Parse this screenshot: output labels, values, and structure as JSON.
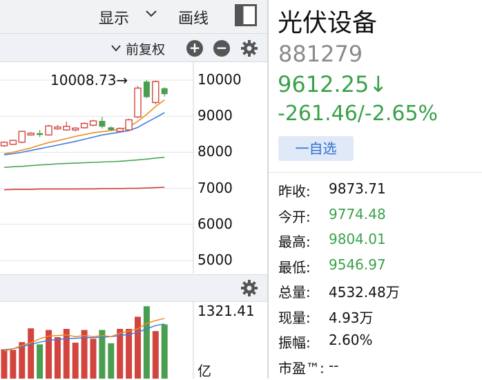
{
  "toolbar": {
    "display_label": "显示",
    "draw_label": "画线",
    "adjust_label": "前复权"
  },
  "price_axis": {
    "ticks": [
      "10000",
      "9000",
      "8000",
      "7000",
      "6000",
      "5000"
    ]
  },
  "high_annotation": "10008.73→",
  "volume_axis": {
    "top_value": "1321.41",
    "unit": "亿"
  },
  "stock": {
    "name": "光伏设备",
    "code": "881279",
    "price": "9612.25↓",
    "change": "-261.46/-2.65%",
    "watchlist_label": "一自选"
  },
  "quote": [
    {
      "label": "昨收:",
      "value": "9873.71",
      "color": "#111111"
    },
    {
      "label": "今开:",
      "value": "9774.48",
      "color": "#3aa14a"
    },
    {
      "label": "最高:",
      "value": "9804.01",
      "color": "#3aa14a"
    },
    {
      "label": "最低:",
      "value": "9546.97",
      "color": "#3aa14a"
    },
    {
      "label": "总量:",
      "value": "4532.48万",
      "color": "#111111"
    },
    {
      "label": "现量:",
      "value": "4.93万",
      "color": "#111111"
    },
    {
      "label": "振幅:",
      "value": "2.60%",
      "color": "#111111"
    },
    {
      "label": "市盈™:",
      "value": "--",
      "color": "#111111"
    }
  ],
  "colors": {
    "up": "#d2453e",
    "down": "#4a9e4f",
    "ma5": "#f08a22",
    "ma10": "#3d7de0",
    "ma30": "#4aa653",
    "ma60": "#d23f38"
  },
  "chart_data": {
    "type": "candlestick",
    "price_ylim": [
      5000,
      10200
    ],
    "candles": [
      {
        "o": 8180,
        "c": 8280,
        "h": 8300,
        "l": 8150,
        "dir": "up"
      },
      {
        "o": 8220,
        "c": 8330,
        "h": 8350,
        "l": 8200,
        "dir": "up"
      },
      {
        "o": 8280,
        "c": 8580,
        "h": 8600,
        "l": 8250,
        "dir": "up"
      },
      {
        "o": 8480,
        "c": 8530,
        "h": 8560,
        "l": 8460,
        "dir": "up"
      },
      {
        "o": 8530,
        "c": 8480,
        "h": 8620,
        "l": 8420,
        "dir": "down"
      },
      {
        "o": 8480,
        "c": 8730,
        "h": 8760,
        "l": 8460,
        "dir": "up"
      },
      {
        "o": 8650,
        "c": 8700,
        "h": 8760,
        "l": 8620,
        "dir": "up"
      },
      {
        "o": 8620,
        "c": 8720,
        "h": 8850,
        "l": 8600,
        "dir": "up"
      },
      {
        "o": 8620,
        "c": 8670,
        "h": 8700,
        "l": 8580,
        "dir": "up"
      },
      {
        "o": 8680,
        "c": 8800,
        "h": 8830,
        "l": 8660,
        "dir": "up"
      },
      {
        "o": 8750,
        "c": 8870,
        "h": 8900,
        "l": 8720,
        "dir": "up"
      },
      {
        "o": 8870,
        "c": 8710,
        "h": 8980,
        "l": 8660,
        "dir": "down"
      },
      {
        "o": 8690,
        "c": 8620,
        "h": 8720,
        "l": 8600,
        "dir": "down"
      },
      {
        "o": 8580,
        "c": 8660,
        "h": 8690,
        "l": 8560,
        "dir": "up"
      },
      {
        "o": 8620,
        "c": 8900,
        "h": 8930,
        "l": 8600,
        "dir": "up"
      },
      {
        "o": 8980,
        "c": 9780,
        "h": 9840,
        "l": 8950,
        "dir": "up"
      },
      {
        "o": 9960,
        "c": 9530,
        "h": 10008.73,
        "l": 9500,
        "dir": "down"
      },
      {
        "o": 9380,
        "c": 9960,
        "h": 9990,
        "l": 9330,
        "dir": "up"
      },
      {
        "o": 9774.48,
        "c": 9612.25,
        "h": 9804.01,
        "l": 9546.97,
        "dir": "down"
      }
    ],
    "ma5": [
      7960,
      8000,
      8060,
      8120,
      8200,
      8270,
      8320,
      8380,
      8440,
      8490,
      8540,
      8570,
      8600,
      8640,
      8700,
      8860,
      9050,
      9270,
      9450
    ],
    "ma10": [
      7930,
      7960,
      8000,
      8050,
      8100,
      8150,
      8200,
      8250,
      8300,
      8360,
      8420,
      8480,
      8520,
      8560,
      8600,
      8690,
      8830,
      8960,
      9100
    ],
    "ma30": [
      7580,
      7600,
      7610,
      7630,
      7650,
      7660,
      7680,
      7690,
      7700,
      7710,
      7720,
      7730,
      7740,
      7750,
      7770,
      7790,
      7810,
      7840,
      7860
    ],
    "ma60": [
      6960,
      6970,
      6970,
      6970,
      6980,
      6980,
      6980,
      6980,
      6980,
      6985,
      6985,
      6990,
      6990,
      6995,
      7000,
      7000,
      7010,
      7020,
      7030
    ],
    "volume_ylim": [
      0,
      1400
    ],
    "volume": [
      530,
      520,
      660,
      910,
      620,
      880,
      750,
      900,
      650,
      880,
      720,
      880,
      640,
      900,
      900,
      1120,
      1310,
      860,
      980
    ],
    "vol_ma5": [
      500,
      540,
      600,
      650,
      720,
      770,
      780,
      790,
      760,
      780,
      760,
      780,
      760,
      820,
      860,
      900,
      1000,
      1050,
      1090
    ],
    "vol_ma10": [
      520,
      540,
      580,
      620,
      660,
      690,
      710,
      720,
      730,
      740,
      740,
      750,
      760,
      780,
      800,
      840,
      900,
      960,
      990
    ]
  }
}
